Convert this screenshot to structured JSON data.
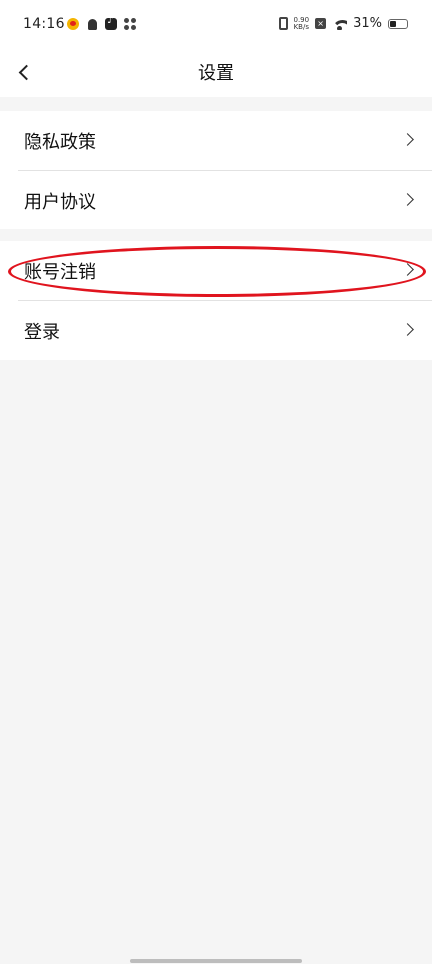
{
  "status_bar": {
    "time": "14:16",
    "left_icons": [
      "weibo-icon",
      "bulb-icon",
      "tiktok-icon",
      "fan-icon"
    ],
    "network_speed_value": "0.90",
    "network_speed_unit": "KB/s",
    "battery_percent_text": "31%",
    "battery_level": 0.31
  },
  "navbar": {
    "title": "设置",
    "back_icon": "chevron-left-icon"
  },
  "settings": {
    "group1": [
      {
        "label": "隐私政策"
      },
      {
        "label": "用户协议"
      }
    ],
    "group2": [
      {
        "label": "账号注销"
      },
      {
        "label": "登录"
      }
    ]
  },
  "colors": {
    "background": "#f5f5f5",
    "card": "#ffffff",
    "highlight": "#e0141e"
  }
}
